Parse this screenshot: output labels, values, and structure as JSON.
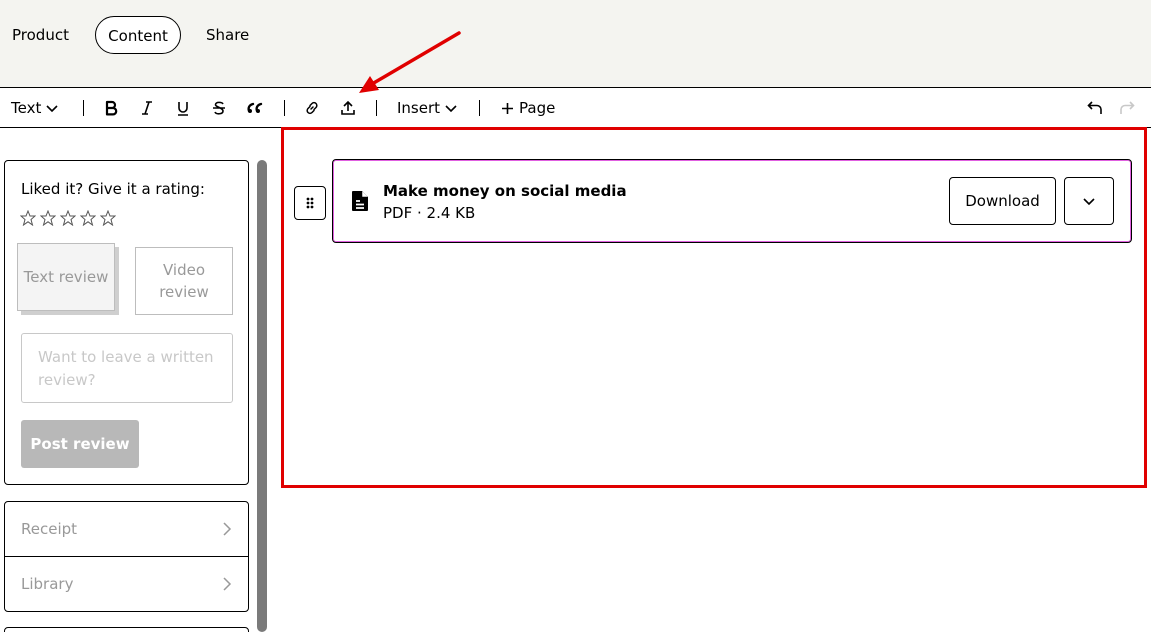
{
  "nav": {
    "product": "Product",
    "content": "Content",
    "share": "Share"
  },
  "toolbar": {
    "text_style": "Text",
    "insert": "Insert",
    "page": "Page",
    "icons": [
      "bold-icon",
      "italic-icon",
      "underline-icon",
      "strikethrough-icon",
      "quote-icon",
      "link-icon",
      "upload-icon",
      "undo-icon",
      "redo-icon"
    ]
  },
  "review": {
    "title": "Liked it? Give it a rating:",
    "star_count": 5,
    "text_review": "Text review",
    "video_review": "Video review",
    "placeholder": "Want to leave a written review?",
    "post_button": "Post review"
  },
  "sidebar_links": {
    "receipt": "Receipt",
    "library": "Library"
  },
  "file": {
    "name": "Make money on social media",
    "meta": "PDF · 2.4 KB",
    "download": "Download"
  },
  "colors": {
    "topbar_bg": "#f4f4f0",
    "annotation_red": "#e00000",
    "selected_outline": "#e060e0",
    "disabled_button": "#b8b8b8"
  }
}
